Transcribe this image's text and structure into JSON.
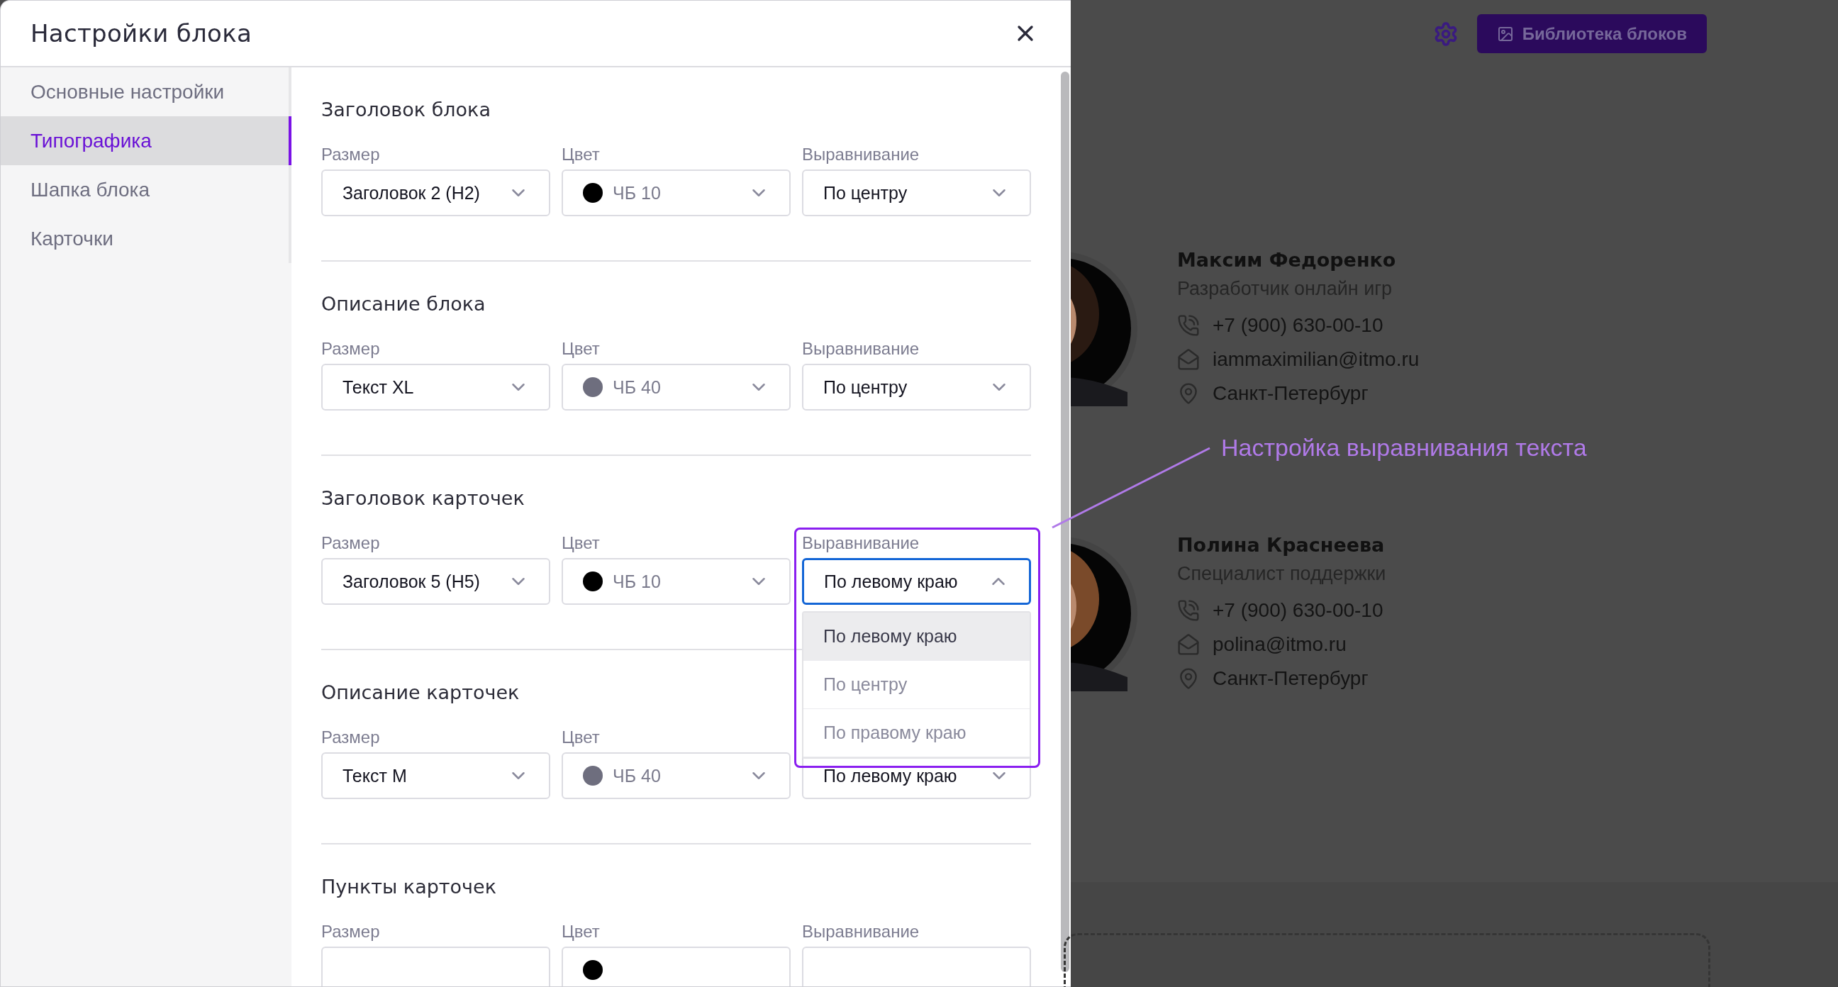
{
  "dialog": {
    "title": "Настройки блока"
  },
  "sidebar": {
    "items": [
      {
        "label": "Основные настройки",
        "selected": false
      },
      {
        "label": "Типографика",
        "selected": true
      },
      {
        "label": "Шапка блока",
        "selected": false
      },
      {
        "label": "Карточки",
        "selected": false
      }
    ]
  },
  "sections": [
    {
      "title": "Заголовок блока",
      "fields": [
        {
          "kind": "select",
          "label": "Размер",
          "value": "Заголовок 2 (H2)",
          "open": false
        },
        {
          "kind": "color",
          "label": "Цвет",
          "value": "ЧБ 10",
          "color": "#000000",
          "open": false
        },
        {
          "kind": "select",
          "label": "Выравнивание",
          "value": "По центру",
          "open": false
        }
      ]
    },
    {
      "title": "Описание блока",
      "fields": [
        {
          "kind": "select",
          "label": "Размер",
          "value": "Текст XL",
          "open": false
        },
        {
          "kind": "color",
          "label": "Цвет",
          "value": "ЧБ 40",
          "color": "#6e6e7e",
          "open": false
        },
        {
          "kind": "select",
          "label": "Выравнивание",
          "value": "По центру",
          "open": false
        }
      ]
    },
    {
      "title": "Заголовок карточек",
      "fields": [
        {
          "kind": "select",
          "label": "Размер",
          "value": "Заголовок 5 (H5)",
          "open": false
        },
        {
          "kind": "color",
          "label": "Цвет",
          "value": "ЧБ 10",
          "color": "#000000",
          "open": false
        },
        {
          "kind": "select",
          "label": "Выравнивание",
          "value": "По левому краю",
          "open": true,
          "highlighted": true,
          "options": [
            {
              "label": "По левому краю",
              "selected": true
            },
            {
              "label": "По центру",
              "selected": false
            },
            {
              "label": "По правому краю",
              "selected": false
            }
          ]
        }
      ]
    },
    {
      "title": "Описание карточек",
      "fields": [
        {
          "kind": "select",
          "label": "Размер",
          "value": "Текст M",
          "open": false
        },
        {
          "kind": "color",
          "label": "Цвет",
          "value": "ЧБ 40",
          "color": "#6e6e7e",
          "open": false
        },
        {
          "kind": "select",
          "value": "По левому краю",
          "open": false
        }
      ]
    },
    {
      "title": "Пункты карточек",
      "fields": [
        {
          "kind": "select",
          "label": "Размер",
          "open": false
        },
        {
          "kind": "color",
          "label": "Цвет",
          "color": "#000000",
          "open": false
        },
        {
          "kind": "select",
          "label": "Выравнивание",
          "open": false
        }
      ]
    }
  ],
  "background": {
    "library_button": "Библиотека блоков",
    "people": [
      {
        "name": "Максим Федоренко",
        "role": "Разработчик онлайн игр",
        "phone": "+7 (900) 630-00-10",
        "email": "iammaximilian@itmo.ru",
        "city": "Санкт-Петербург"
      },
      {
        "name": "Полина Краснеева",
        "role": "Специалист поддержки",
        "phone": "+7 (900) 630-00-10",
        "email": "polina@itmo.ru",
        "city": "Санкт-Петербург"
      }
    ]
  },
  "annotation": {
    "text": "Настройка выравнивания текста"
  }
}
